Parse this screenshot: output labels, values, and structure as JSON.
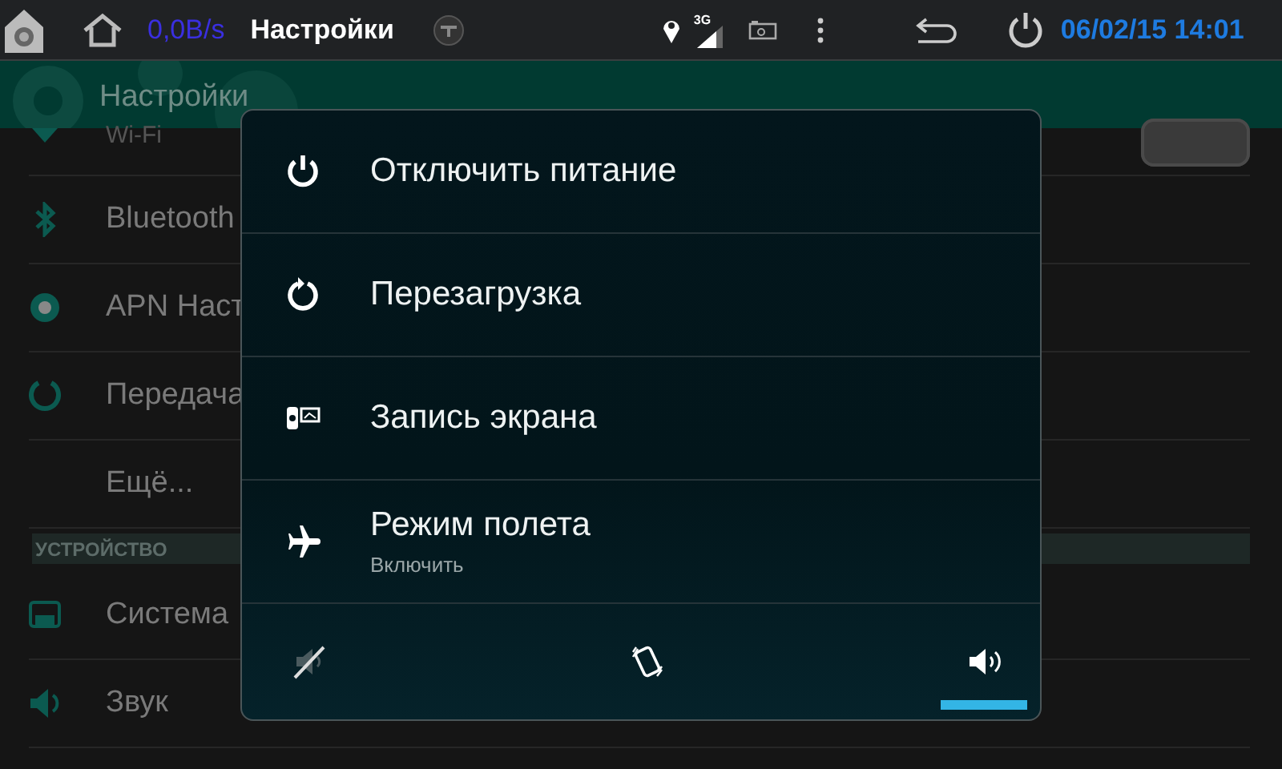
{
  "status_bar": {
    "speed": "0,0B/s",
    "title": "Настройки",
    "network": "3G",
    "datetime": "06/02/15 14:01"
  },
  "header": {
    "title": "Настройки"
  },
  "settings": [
    {
      "kind": "toggle",
      "label": "Wi-Fi",
      "on": false
    },
    {
      "kind": "item",
      "label": "Bluetooth"
    },
    {
      "kind": "item",
      "label": "APN Наст"
    },
    {
      "kind": "item",
      "label": "Передача"
    },
    {
      "kind": "item",
      "label": "Ещё..."
    },
    {
      "kind": "section",
      "label": "УСТРОЙСТВО"
    },
    {
      "kind": "item",
      "label": "Система"
    },
    {
      "kind": "item",
      "label": "Звук"
    }
  ],
  "power_menu": {
    "items": [
      {
        "label": "Отключить питание"
      },
      {
        "label": "Перезагрузка"
      },
      {
        "label": "Запись экрана"
      },
      {
        "label": "Режим полета",
        "subtitle": "Включить"
      }
    ],
    "sound_modes": [
      {
        "selected": false
      },
      {
        "selected": false
      },
      {
        "selected": true
      }
    ]
  }
}
